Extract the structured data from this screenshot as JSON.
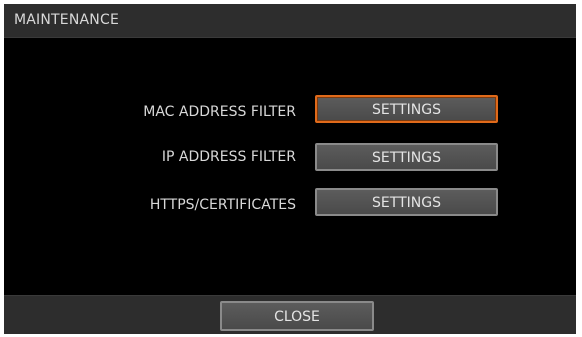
{
  "dialog": {
    "title": "MAINTENANCE"
  },
  "rows": [
    {
      "label": "MAC ADDRESS FILTER",
      "button_label": "SETTINGS",
      "focused": true
    },
    {
      "label": "IP ADDRESS FILTER",
      "button_label": "SETTINGS",
      "focused": false
    },
    {
      "label": "HTTPS/CERTIFICATES",
      "button_label": "SETTINGS",
      "focused": false
    }
  ],
  "footer": {
    "close_label": "CLOSE"
  },
  "colors": {
    "background": "#000000",
    "bar": "#2d2d2d",
    "focus_border": "#e06a1a",
    "button_face": "#555555",
    "text": "#d8d8d8"
  }
}
